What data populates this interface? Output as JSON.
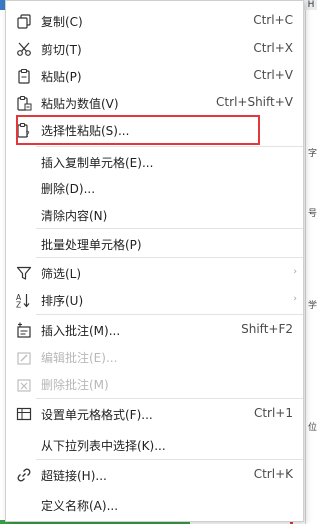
{
  "background": {
    "column_letter": "H",
    "glyphs": [
      "字",
      "号",
      "学",
      "位"
    ]
  },
  "context_menu": {
    "items": [
      {
        "label": "复制(C)",
        "shortcut": "Ctrl+C",
        "icon": "copy-icon",
        "disabled": false
      },
      {
        "label": "剪切(T)",
        "shortcut": "Ctrl+X",
        "icon": "scissors-icon",
        "disabled": false
      },
      {
        "label": "粘贴(P)",
        "shortcut": "Ctrl+V",
        "icon": "paste-icon",
        "disabled": false
      },
      {
        "label": "粘贴为数值(V)",
        "shortcut": "Ctrl+Shift+V",
        "icon": "paste-value-icon",
        "disabled": false
      },
      {
        "label": "选择性粘贴(S)...",
        "shortcut": "",
        "icon": "paste-special-icon",
        "disabled": false
      },
      {
        "label": "插入复制单元格(E)...",
        "shortcut": "",
        "icon": "",
        "disabled": false
      },
      {
        "label": "删除(D)...",
        "shortcut": "",
        "icon": "",
        "disabled": false
      },
      {
        "label": "清除内容(N)",
        "shortcut": "",
        "icon": "",
        "disabled": false
      },
      {
        "label": "批量处理单元格(P)",
        "shortcut": "",
        "icon": "",
        "disabled": false
      },
      {
        "label": "筛选(L)",
        "shortcut": "",
        "icon": "filter-icon",
        "disabled": false,
        "submenu": true
      },
      {
        "label": "排序(U)",
        "shortcut": "",
        "icon": "sort-icon",
        "disabled": false,
        "submenu": true
      },
      {
        "label": "插入批注(M)...",
        "shortcut": "Shift+F2",
        "icon": "insert-comment-icon",
        "disabled": false
      },
      {
        "label": "编辑批注(E)...",
        "shortcut": "",
        "icon": "edit-comment-icon",
        "disabled": true
      },
      {
        "label": "删除批注(M)",
        "shortcut": "",
        "icon": "delete-comment-icon",
        "disabled": true
      },
      {
        "label": "设置单元格格式(F)...",
        "shortcut": "Ctrl+1",
        "icon": "format-cells-icon",
        "disabled": false
      },
      {
        "label": "从下拉列表中选择(K)...",
        "shortcut": "",
        "icon": "",
        "disabled": false
      },
      {
        "label": "超链接(H)...",
        "shortcut": "Ctrl+K",
        "icon": "link-icon",
        "disabled": false
      },
      {
        "label": "定义名称(A)...",
        "shortcut": "",
        "icon": "",
        "disabled": false
      }
    ],
    "submenu_arrow": "›",
    "highlight_color": "#e0383c"
  }
}
